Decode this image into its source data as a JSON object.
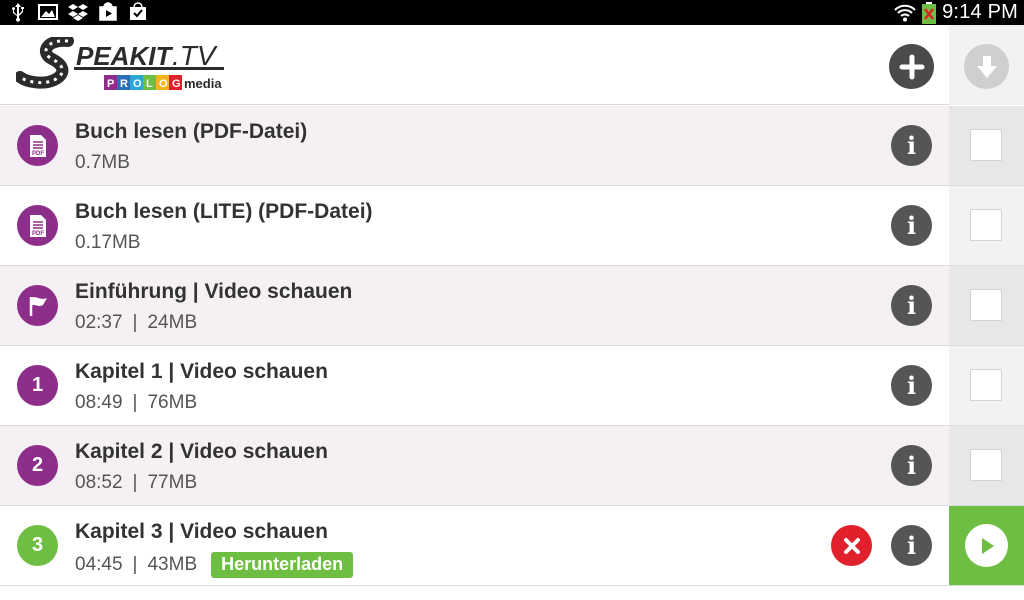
{
  "status_bar": {
    "time": "9:14 PM",
    "left_icons": [
      "usb-icon",
      "image-icon",
      "dropbox-icon",
      "play-store-icon",
      "shopping-bag-icon"
    ],
    "right_icons": [
      "wifi-icon",
      "battery-charging-icon"
    ]
  },
  "header": {
    "logo": {
      "brand": "SPEAKIT.TV",
      "sub_brand_colored": "PROLOG",
      "sub_brand_suffix": "media"
    },
    "add_icon": "plus-icon",
    "download_icon": "download-arrow-icon"
  },
  "colors": {
    "accent_purple": "#8e2e8b",
    "accent_green": "#6fbe44",
    "cancel_red": "#e0202a",
    "dark_gray": "#4b4b4b"
  },
  "items": [
    {
      "icon": "pdf-file-icon",
      "title": "Buch lesen (PDF-Datei)",
      "duration": "",
      "size": "0.7MB",
      "badge": "",
      "state": "checkbox"
    },
    {
      "icon": "pdf-file-icon",
      "title": "Buch lesen (LITE) (PDF-Datei)",
      "duration": "",
      "size": "0.17MB",
      "badge": "",
      "state": "checkbox"
    },
    {
      "icon": "flag-icon",
      "title": "Einführung | Video schauen",
      "duration": "02:37",
      "size": "24MB",
      "badge": "",
      "state": "checkbox"
    },
    {
      "number": "1",
      "title": "Kapitel 1 | Video schauen",
      "duration": "08:49",
      "size": "76MB",
      "badge": "",
      "state": "checkbox"
    },
    {
      "number": "2",
      "title": "Kapitel 2 | Video schauen",
      "duration": "08:52",
      "size": "77MB",
      "badge": "",
      "state": "checkbox"
    },
    {
      "number": "3",
      "title": "Kapitel 3 | Video schauen",
      "duration": "04:45",
      "size": "43MB",
      "badge": "Herunterladen",
      "state": "play"
    }
  ],
  "meta_separator": "|",
  "info_glyph": "i"
}
